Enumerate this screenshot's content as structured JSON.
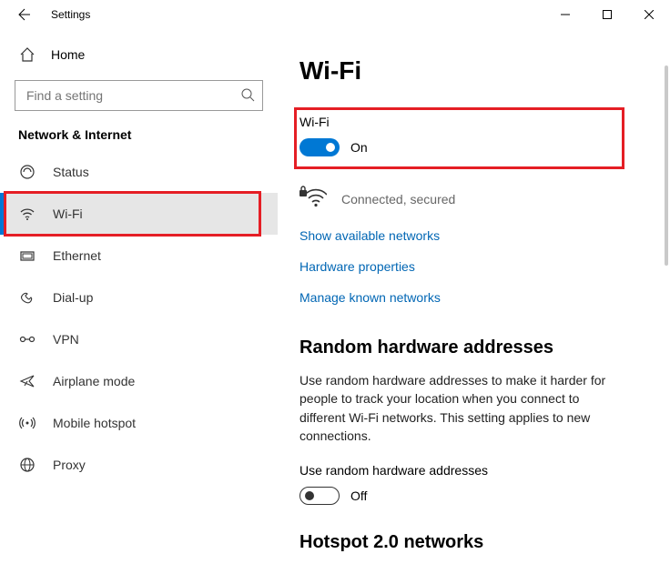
{
  "window": {
    "title": "Settings"
  },
  "sidebar": {
    "home_label": "Home",
    "search_placeholder": "Find a setting",
    "section": "Network & Internet",
    "items": [
      {
        "icon": "status",
        "label": "Status"
      },
      {
        "icon": "wifi",
        "label": "Wi-Fi",
        "selected": true
      },
      {
        "icon": "ethernet",
        "label": "Ethernet"
      },
      {
        "icon": "dialup",
        "label": "Dial-up"
      },
      {
        "icon": "vpn",
        "label": "VPN"
      },
      {
        "icon": "airplane",
        "label": "Airplane mode"
      },
      {
        "icon": "hotspot",
        "label": "Mobile hotspot"
      },
      {
        "icon": "proxy",
        "label": "Proxy"
      }
    ]
  },
  "main": {
    "title": "Wi-Fi",
    "wifi_toggle": {
      "label": "Wi-Fi",
      "state_text": "On",
      "on": true
    },
    "connection_status": "Connected, secured",
    "links": {
      "show_networks": "Show available networks",
      "hardware_props": "Hardware properties",
      "manage_known": "Manage known networks"
    },
    "random_hw": {
      "title": "Random hardware addresses",
      "body": "Use random hardware addresses to make it harder for people to track your location when you connect to different Wi-Fi networks. This setting applies to new connections.",
      "sub_label": "Use random hardware addresses",
      "state_text": "Off",
      "on": false
    },
    "hotspot2": {
      "title": "Hotspot 2.0 networks"
    }
  }
}
